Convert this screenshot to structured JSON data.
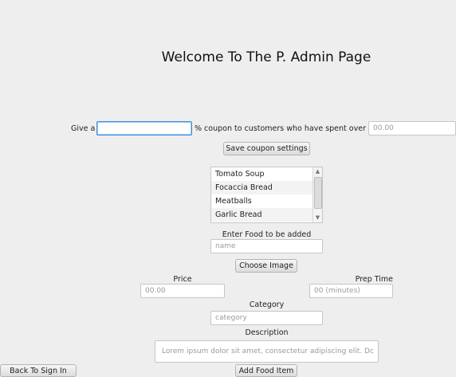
{
  "page": {
    "title": "Welcome To The P. Admin Page"
  },
  "coupon": {
    "give_label": "Give a",
    "percent_value": "",
    "middle_label": "% coupon to customers who have spent over $",
    "threshold_placeholder": "00.00",
    "save_button": "Save coupon settings"
  },
  "menu_list": {
    "items": [
      "Tomato Soup",
      "Focaccia Bread",
      "Meatballs",
      "Garlic Bread"
    ]
  },
  "add_food": {
    "name_label": "Enter Food to be added",
    "name_placeholder": "name",
    "choose_image_button": "Choose Image",
    "price_label": "Price",
    "price_placeholder": "00.00",
    "prep_time_label": "Prep Time",
    "prep_time_placeholder": "00 (minutes)",
    "category_label": "Category",
    "category_placeholder": "category",
    "description_label": "Description",
    "description_placeholder": "Lorem ipsum dolor sit amet, consectetur adipiscing elit. Dc",
    "add_button": "Add Food Item"
  },
  "nav": {
    "back_button": "Back To Sign In"
  },
  "colors": {
    "background": "#eeeeee",
    "focus_border": "#3d8ee2"
  },
  "icons": {
    "scroll_up": "chevron-up-icon",
    "scroll_down": "chevron-down-icon"
  }
}
